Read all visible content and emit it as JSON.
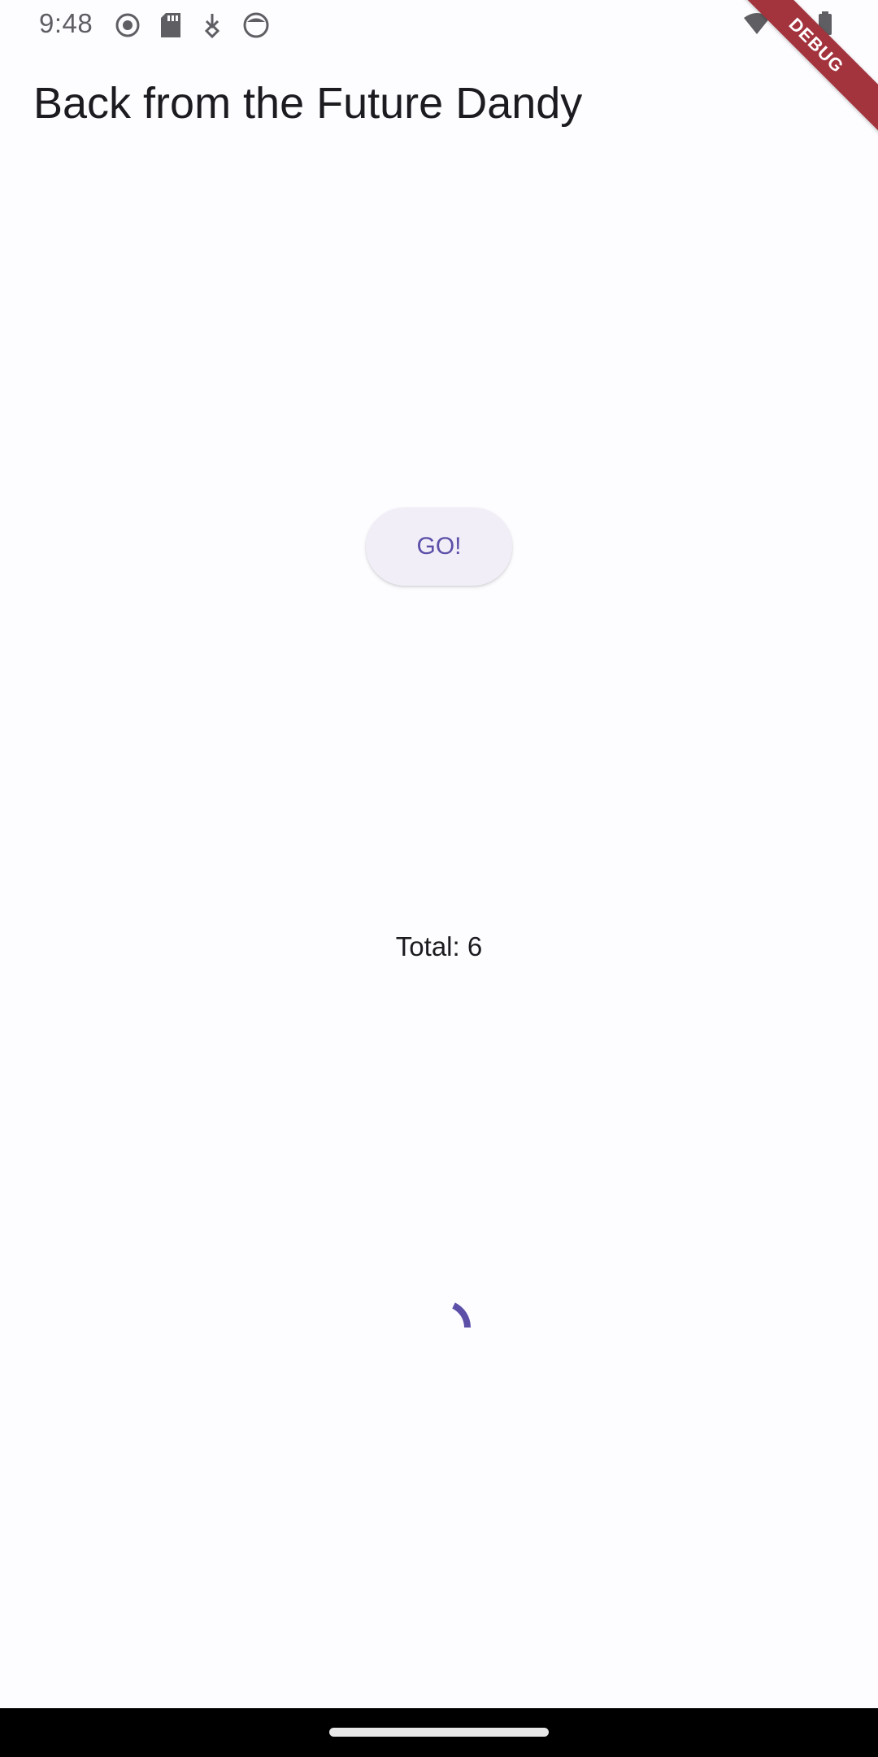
{
  "status_bar": {
    "time": "9:48",
    "left_icons": [
      "recording-icon",
      "sd-card-icon",
      "download-icon",
      "app-icon"
    ],
    "right_icons": [
      "wifi-icon",
      "signal-icon",
      "battery-icon"
    ]
  },
  "debug_banner": {
    "label": "DEBUG",
    "color": "#a3333d"
  },
  "app_bar": {
    "title": "Back from the Future Dandy"
  },
  "main": {
    "go_button_label": "GO!",
    "total_text": "Total: 6"
  },
  "colors": {
    "accent": "#5b4fa8",
    "button_bg": "#f1eef8",
    "background": "#fdfcff",
    "text": "#1c1b1f"
  }
}
